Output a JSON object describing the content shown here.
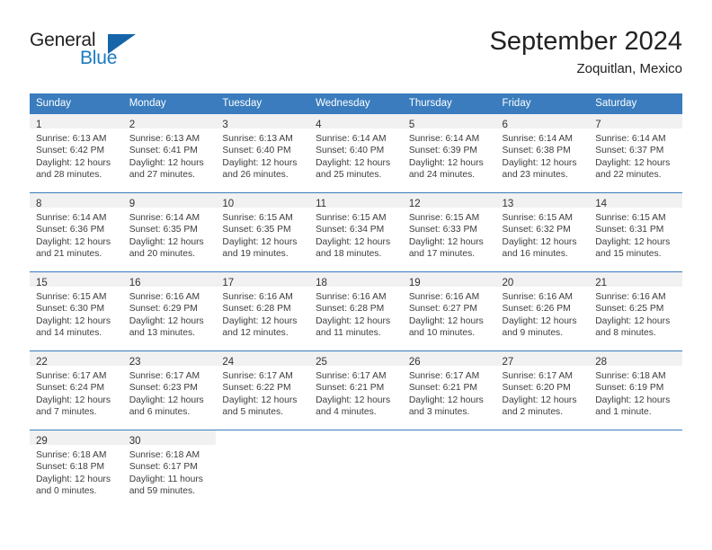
{
  "brand": {
    "name_part1": "General",
    "name_part2": "Blue",
    "triangle_color": "#1565a8",
    "blue_color": "#1b7bc1",
    "dark_color": "#231f20"
  },
  "header": {
    "month_title": "September 2024",
    "location": "Zoquitlan, Mexico"
  },
  "theme": {
    "header_blue": "#3a7cbe",
    "daynum_band": "#f1f1f1",
    "text": "#3d3d3d"
  },
  "weekday_headers": [
    "Sunday",
    "Monday",
    "Tuesday",
    "Wednesday",
    "Thursday",
    "Friday",
    "Saturday"
  ],
  "weeks": [
    [
      {
        "day": "1",
        "sunrise": "Sunrise: 6:13 AM",
        "sunset": "Sunset: 6:42 PM",
        "daylight1": "Daylight: 12 hours",
        "daylight2": "and 28 minutes."
      },
      {
        "day": "2",
        "sunrise": "Sunrise: 6:13 AM",
        "sunset": "Sunset: 6:41 PM",
        "daylight1": "Daylight: 12 hours",
        "daylight2": "and 27 minutes."
      },
      {
        "day": "3",
        "sunrise": "Sunrise: 6:13 AM",
        "sunset": "Sunset: 6:40 PM",
        "daylight1": "Daylight: 12 hours",
        "daylight2": "and 26 minutes."
      },
      {
        "day": "4",
        "sunrise": "Sunrise: 6:14 AM",
        "sunset": "Sunset: 6:40 PM",
        "daylight1": "Daylight: 12 hours",
        "daylight2": "and 25 minutes."
      },
      {
        "day": "5",
        "sunrise": "Sunrise: 6:14 AM",
        "sunset": "Sunset: 6:39 PM",
        "daylight1": "Daylight: 12 hours",
        "daylight2": "and 24 minutes."
      },
      {
        "day": "6",
        "sunrise": "Sunrise: 6:14 AM",
        "sunset": "Sunset: 6:38 PM",
        "daylight1": "Daylight: 12 hours",
        "daylight2": "and 23 minutes."
      },
      {
        "day": "7",
        "sunrise": "Sunrise: 6:14 AM",
        "sunset": "Sunset: 6:37 PM",
        "daylight1": "Daylight: 12 hours",
        "daylight2": "and 22 minutes."
      }
    ],
    [
      {
        "day": "8",
        "sunrise": "Sunrise: 6:14 AM",
        "sunset": "Sunset: 6:36 PM",
        "daylight1": "Daylight: 12 hours",
        "daylight2": "and 21 minutes."
      },
      {
        "day": "9",
        "sunrise": "Sunrise: 6:14 AM",
        "sunset": "Sunset: 6:35 PM",
        "daylight1": "Daylight: 12 hours",
        "daylight2": "and 20 minutes."
      },
      {
        "day": "10",
        "sunrise": "Sunrise: 6:15 AM",
        "sunset": "Sunset: 6:35 PM",
        "daylight1": "Daylight: 12 hours",
        "daylight2": "and 19 minutes."
      },
      {
        "day": "11",
        "sunrise": "Sunrise: 6:15 AM",
        "sunset": "Sunset: 6:34 PM",
        "daylight1": "Daylight: 12 hours",
        "daylight2": "and 18 minutes."
      },
      {
        "day": "12",
        "sunrise": "Sunrise: 6:15 AM",
        "sunset": "Sunset: 6:33 PM",
        "daylight1": "Daylight: 12 hours",
        "daylight2": "and 17 minutes."
      },
      {
        "day": "13",
        "sunrise": "Sunrise: 6:15 AM",
        "sunset": "Sunset: 6:32 PM",
        "daylight1": "Daylight: 12 hours",
        "daylight2": "and 16 minutes."
      },
      {
        "day": "14",
        "sunrise": "Sunrise: 6:15 AM",
        "sunset": "Sunset: 6:31 PM",
        "daylight1": "Daylight: 12 hours",
        "daylight2": "and 15 minutes."
      }
    ],
    [
      {
        "day": "15",
        "sunrise": "Sunrise: 6:15 AM",
        "sunset": "Sunset: 6:30 PM",
        "daylight1": "Daylight: 12 hours",
        "daylight2": "and 14 minutes."
      },
      {
        "day": "16",
        "sunrise": "Sunrise: 6:16 AM",
        "sunset": "Sunset: 6:29 PM",
        "daylight1": "Daylight: 12 hours",
        "daylight2": "and 13 minutes."
      },
      {
        "day": "17",
        "sunrise": "Sunrise: 6:16 AM",
        "sunset": "Sunset: 6:28 PM",
        "daylight1": "Daylight: 12 hours",
        "daylight2": "and 12 minutes."
      },
      {
        "day": "18",
        "sunrise": "Sunrise: 6:16 AM",
        "sunset": "Sunset: 6:28 PM",
        "daylight1": "Daylight: 12 hours",
        "daylight2": "and 11 minutes."
      },
      {
        "day": "19",
        "sunrise": "Sunrise: 6:16 AM",
        "sunset": "Sunset: 6:27 PM",
        "daylight1": "Daylight: 12 hours",
        "daylight2": "and 10 minutes."
      },
      {
        "day": "20",
        "sunrise": "Sunrise: 6:16 AM",
        "sunset": "Sunset: 6:26 PM",
        "daylight1": "Daylight: 12 hours",
        "daylight2": "and 9 minutes."
      },
      {
        "day": "21",
        "sunrise": "Sunrise: 6:16 AM",
        "sunset": "Sunset: 6:25 PM",
        "daylight1": "Daylight: 12 hours",
        "daylight2": "and 8 minutes."
      }
    ],
    [
      {
        "day": "22",
        "sunrise": "Sunrise: 6:17 AM",
        "sunset": "Sunset: 6:24 PM",
        "daylight1": "Daylight: 12 hours",
        "daylight2": "and 7 minutes."
      },
      {
        "day": "23",
        "sunrise": "Sunrise: 6:17 AM",
        "sunset": "Sunset: 6:23 PM",
        "daylight1": "Daylight: 12 hours",
        "daylight2": "and 6 minutes."
      },
      {
        "day": "24",
        "sunrise": "Sunrise: 6:17 AM",
        "sunset": "Sunset: 6:22 PM",
        "daylight1": "Daylight: 12 hours",
        "daylight2": "and 5 minutes."
      },
      {
        "day": "25",
        "sunrise": "Sunrise: 6:17 AM",
        "sunset": "Sunset: 6:21 PM",
        "daylight1": "Daylight: 12 hours",
        "daylight2": "and 4 minutes."
      },
      {
        "day": "26",
        "sunrise": "Sunrise: 6:17 AM",
        "sunset": "Sunset: 6:21 PM",
        "daylight1": "Daylight: 12 hours",
        "daylight2": "and 3 minutes."
      },
      {
        "day": "27",
        "sunrise": "Sunrise: 6:17 AM",
        "sunset": "Sunset: 6:20 PM",
        "daylight1": "Daylight: 12 hours",
        "daylight2": "and 2 minutes."
      },
      {
        "day": "28",
        "sunrise": "Sunrise: 6:18 AM",
        "sunset": "Sunset: 6:19 PM",
        "daylight1": "Daylight: 12 hours",
        "daylight2": "and 1 minute."
      }
    ],
    [
      {
        "day": "29",
        "sunrise": "Sunrise: 6:18 AM",
        "sunset": "Sunset: 6:18 PM",
        "daylight1": "Daylight: 12 hours",
        "daylight2": "and 0 minutes."
      },
      {
        "day": "30",
        "sunrise": "Sunrise: 6:18 AM",
        "sunset": "Sunset: 6:17 PM",
        "daylight1": "Daylight: 11 hours",
        "daylight2": "and 59 minutes."
      },
      null,
      null,
      null,
      null,
      null
    ]
  ]
}
